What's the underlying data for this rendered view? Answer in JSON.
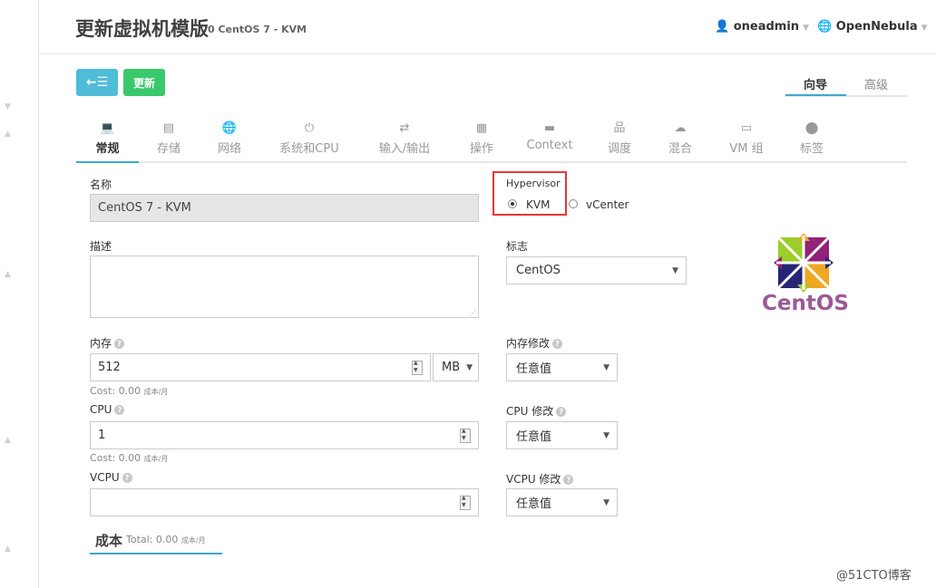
{
  "header": {
    "title": "更新虚拟机模版",
    "subtitle": "0 CentOS 7 - KVM",
    "user": "oneadmin",
    "zone": "OpenNebula"
  },
  "toolbar": {
    "back_label": "←☰",
    "update_label": "更新"
  },
  "mode_tabs": [
    {
      "label": "向导",
      "active": true
    },
    {
      "label": "高级",
      "active": false
    }
  ],
  "tabs": [
    {
      "label": "常规",
      "icon": "laptop-icon",
      "glyph": "💻",
      "active": true
    },
    {
      "label": "存储",
      "icon": "storage-icon",
      "glyph": "▤",
      "active": false
    },
    {
      "label": "网络",
      "icon": "globe-icon",
      "glyph": "🌐",
      "active": false
    },
    {
      "label": "系统和CPU",
      "icon": "power-icon",
      "glyph": "⏻",
      "active": false
    },
    {
      "label": "输入/输出",
      "icon": "exchange-icon",
      "glyph": "⇄",
      "active": false
    },
    {
      "label": "操作",
      "icon": "calendar-icon",
      "glyph": "▦",
      "active": false
    },
    {
      "label": "Context",
      "icon": "folder-icon",
      "glyph": "▬",
      "active": false
    },
    {
      "label": "调度",
      "icon": "sitemap-icon",
      "glyph": "品",
      "active": false
    },
    {
      "label": "混合",
      "icon": "cloud-icon",
      "glyph": "☁",
      "active": false
    },
    {
      "label": "VM 组",
      "icon": "folder-open-icon",
      "glyph": "▭",
      "active": false
    },
    {
      "label": "标签",
      "icon": "tag-icon",
      "glyph": "⬤",
      "active": false
    }
  ],
  "form": {
    "name_label": "名称",
    "name_value": "CentOS 7 - KVM",
    "description_label": "描述",
    "description_value": "",
    "hypervisor_label": "Hypervisor",
    "hypervisor_options": [
      "KVM",
      "vCenter"
    ],
    "hypervisor_selected": "KVM",
    "logo_label": "标志",
    "logo_value": "CentOS",
    "memory_label": "内存",
    "memory_value": "512",
    "memory_unit": "MB",
    "memory_cost": "Cost: 0.00",
    "memory_cost_unit": "成本/月",
    "memory_mod_label": "内存修改",
    "memory_mod_value": "任意值",
    "cpu_label": "CPU",
    "cpu_value": "1",
    "cpu_cost": "Cost: 0.00",
    "cpu_cost_unit": "成本/月",
    "cpu_mod_label": "CPU 修改",
    "cpu_mod_value": "任意值",
    "vcpu_label": "VCPU",
    "vcpu_value": "",
    "vcpu_mod_label": "VCPU 修改",
    "vcpu_mod_value": "任意值"
  },
  "cost_section": {
    "title": "成本",
    "total": "Total: 0.00",
    "unit": "成本/月"
  },
  "logo": {
    "text": "CentOS"
  },
  "watermark": "@51CTO博客",
  "colors": {
    "accent": "#3fa8d0",
    "back_button": "#4fbcd8",
    "update_button": "#3ac86d",
    "highlight": "#e53935"
  }
}
